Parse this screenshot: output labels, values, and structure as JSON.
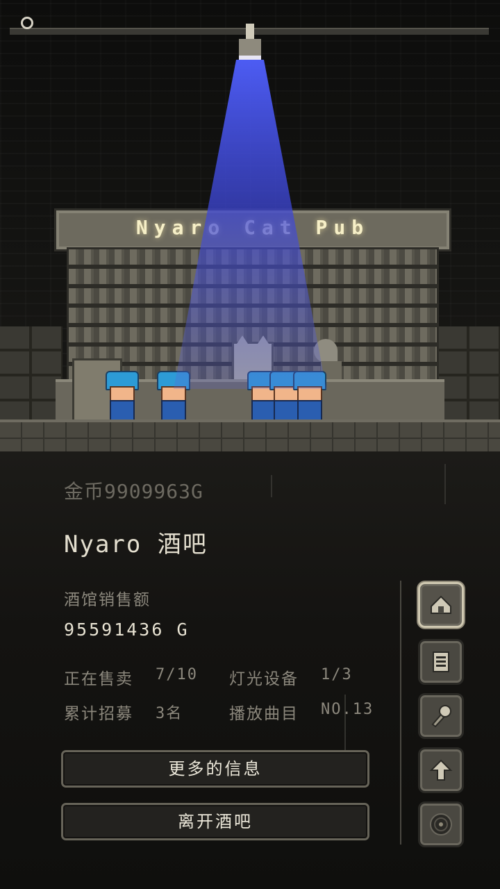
{
  "scene": {
    "sign_text": "Nyaro Cat Pub",
    "spotlight_color": "#3b45d8"
  },
  "info": {
    "gold_line": "金币9909963G",
    "pub_name": "Nyaro 酒吧",
    "sales_label": "酒馆销售额",
    "sales_value": "95591436 G",
    "selling_label": "正在售卖",
    "selling_value": "7/10",
    "lighting_label": "灯光设备",
    "lighting_value": "1/3",
    "recruited_label": "累计招募",
    "recruited_value": "3名",
    "playlist_label": "播放曲目",
    "playlist_value": "NO.13"
  },
  "buttons": {
    "more_info": "更多的信息",
    "leave_pub": "离开酒吧"
  },
  "side_menu": [
    {
      "icon": "home-icon",
      "active": true
    },
    {
      "icon": "menu-book-icon",
      "active": false
    },
    {
      "icon": "microphone-icon",
      "active": false
    },
    {
      "icon": "upgrade-arrow-icon",
      "active": false
    },
    {
      "icon": "record-disc-icon",
      "active": false
    }
  ]
}
